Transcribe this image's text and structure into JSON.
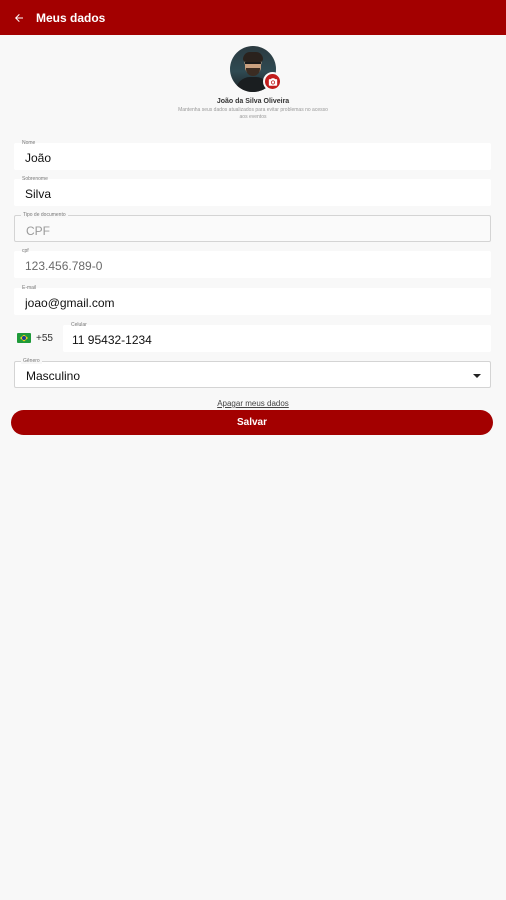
{
  "header": {
    "title": "Meus dados",
    "back_icon": "arrow-left-icon"
  },
  "profile": {
    "name": "João da Silva Oliveira",
    "hint": "Mantenha seus dados atualizados para evitar problemas no acesso aos eventos",
    "camera_icon": "camera-icon"
  },
  "form": {
    "first_name": {
      "label": "Nome",
      "value": "João"
    },
    "last_name": {
      "label": "Sobrenome",
      "value": "Silva"
    },
    "document_type": {
      "label": "Tipo de documento",
      "value": "CPF"
    },
    "cpf": {
      "label": "cpf",
      "value": "123.456.789-0"
    },
    "email": {
      "label": "E-mail",
      "value": "joao@gmail.com"
    },
    "phone": {
      "country_code": "+55",
      "label": "Celular",
      "value": "11 95432-1234",
      "flag_icon": "brazil-flag-icon"
    },
    "gender": {
      "label": "Gênero",
      "value": "Masculino"
    }
  },
  "actions": {
    "delete_label": "Apagar meus dados",
    "save_label": "Salvar"
  },
  "colors": {
    "primary": "#a30000",
    "background": "#f8f8f8"
  }
}
